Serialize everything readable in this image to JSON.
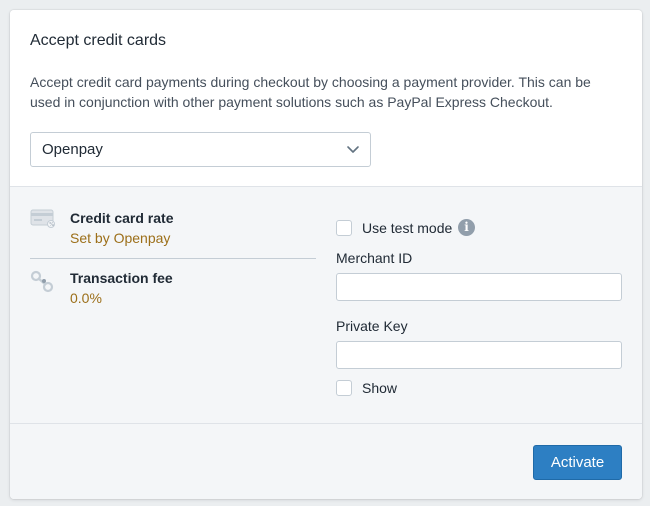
{
  "section": {
    "title": "Accept credit cards",
    "description": "Accept credit card payments during checkout by choosing a payment provider. This can be used in conjunction with other payment solutions such as PayPal Express Checkout."
  },
  "provider_select": {
    "selected": "Openpay",
    "icon": "chevron-down-icon"
  },
  "rates": [
    {
      "label": "Credit card rate",
      "value": "Set by Openpay",
      "icon": "credit-card-icon"
    },
    {
      "label": "Transaction fee",
      "value": "0.0%",
      "icon": "link-icon"
    }
  ],
  "test_mode": {
    "label": "Use test mode",
    "checked": false,
    "icon": "info-icon"
  },
  "fields": {
    "merchant_id": {
      "label": "Merchant ID",
      "value": ""
    },
    "private_key": {
      "label": "Private Key",
      "value": ""
    }
  },
  "show_toggle": {
    "label": "Show",
    "checked": false
  },
  "actions": {
    "activate_label": "Activate"
  },
  "colors": {
    "accent": "#2d7fc3",
    "rate_value": "#9c6f19",
    "panel_bg": "#f4f6f8"
  }
}
